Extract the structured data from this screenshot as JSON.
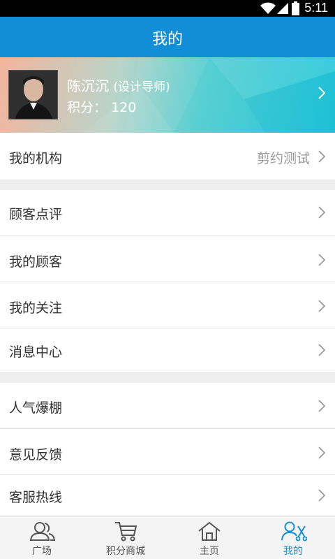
{
  "status_bar": {
    "time": "5:11",
    "icons": [
      "wifi-icon",
      "signal-icon",
      "battery-icon"
    ]
  },
  "header": {
    "title": "我的"
  },
  "profile": {
    "name": "陈沉沉",
    "role": "(设计导师)",
    "points_label": "积分：",
    "points_value": "120"
  },
  "org_row": {
    "label": "我的机构",
    "value": "剪约测试"
  },
  "group1": [
    {
      "label": "顾客点评"
    },
    {
      "label": "我的顾客"
    },
    {
      "label": "我的关注"
    },
    {
      "label": "消息中心"
    }
  ],
  "group2": [
    {
      "label": "人气爆棚"
    },
    {
      "label": "意见反馈"
    },
    {
      "label": "客服热线"
    }
  ],
  "tabs": [
    {
      "label": "广场",
      "icon": "users-icon"
    },
    {
      "label": "积分商城",
      "icon": "cart-icon"
    },
    {
      "label": "主页",
      "icon": "home-icon"
    },
    {
      "label": "我的",
      "icon": "profile-scissors-icon"
    }
  ],
  "colors": {
    "primary": "#118ed5",
    "tab_active": "#118ed5"
  }
}
